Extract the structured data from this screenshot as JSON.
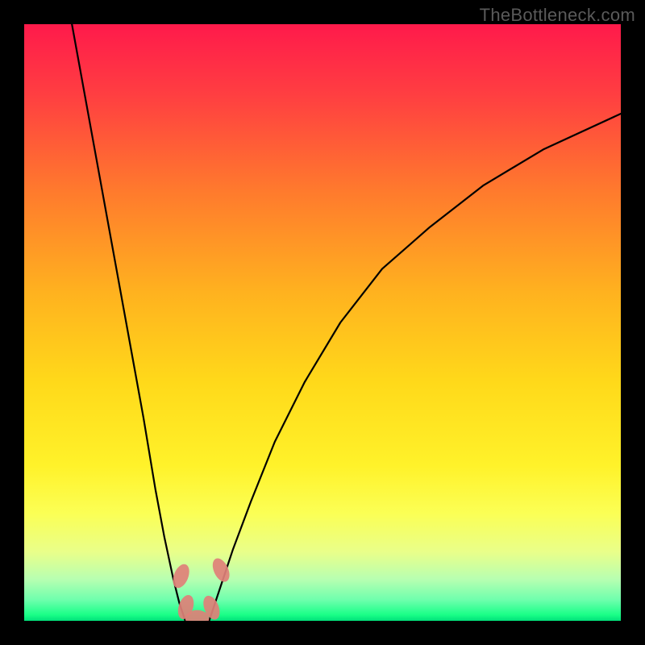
{
  "watermark": "TheBottleneck.com",
  "chart_data": {
    "type": "line",
    "title": "",
    "xlabel": "",
    "ylabel": "",
    "xlim": [
      0,
      100
    ],
    "ylim": [
      0,
      100
    ],
    "grid": false,
    "legend": false,
    "background_gradient_stops": [
      {
        "offset": 0.0,
        "color": "#ff1a4b"
      },
      {
        "offset": 0.12,
        "color": "#ff3f41"
      },
      {
        "offset": 0.28,
        "color": "#ff7a2d"
      },
      {
        "offset": 0.45,
        "color": "#ffb21f"
      },
      {
        "offset": 0.6,
        "color": "#ffd91a"
      },
      {
        "offset": 0.74,
        "color": "#fff22a"
      },
      {
        "offset": 0.82,
        "color": "#fbff55"
      },
      {
        "offset": 0.885,
        "color": "#e9ff8a"
      },
      {
        "offset": 0.93,
        "color": "#b8ffb1"
      },
      {
        "offset": 0.965,
        "color": "#6effad"
      },
      {
        "offset": 0.99,
        "color": "#1aff87"
      },
      {
        "offset": 1.0,
        "color": "#00e07a"
      }
    ],
    "series": [
      {
        "name": "left-branch",
        "color": "#000000",
        "x": [
          8,
          10,
          12,
          14,
          16,
          18,
          20,
          22,
          23.5,
          25,
          26,
          27
        ],
        "y": [
          100,
          89,
          78,
          67,
          56,
          45,
          34,
          22,
          14,
          7,
          3,
          0
        ]
      },
      {
        "name": "right-branch",
        "color": "#000000",
        "x": [
          31,
          33,
          35,
          38,
          42,
          47,
          53,
          60,
          68,
          77,
          87,
          100
        ],
        "y": [
          0,
          6,
          12,
          20,
          30,
          40,
          50,
          59,
          66,
          73,
          79,
          85
        ]
      },
      {
        "name": "valley-floor",
        "color": "#000000",
        "x": [
          27,
          28.5,
          30,
          31
        ],
        "y": [
          0,
          -0.2,
          -0.2,
          0
        ]
      }
    ],
    "markers": [
      {
        "name": "left-cap-upper",
        "cx": 26.3,
        "cy": 7.5,
        "rx": 1.2,
        "ry": 2.1,
        "rot": 22,
        "color": "#e08078"
      },
      {
        "name": "left-cap-lower",
        "cx": 27.1,
        "cy": 2.3,
        "rx": 1.2,
        "ry": 2.1,
        "rot": 18,
        "color": "#e08078"
      },
      {
        "name": "floor-blob",
        "cx": 29.0,
        "cy": 0.4,
        "rx": 2.0,
        "ry": 1.4,
        "rot": 0,
        "color": "#e08078"
      },
      {
        "name": "right-cap-lower",
        "cx": 31.4,
        "cy": 2.2,
        "rx": 1.2,
        "ry": 2.1,
        "rot": -22,
        "color": "#e08078"
      },
      {
        "name": "right-cap-upper",
        "cx": 33.0,
        "cy": 8.5,
        "rx": 1.2,
        "ry": 2.1,
        "rot": -25,
        "color": "#e08078"
      }
    ]
  }
}
